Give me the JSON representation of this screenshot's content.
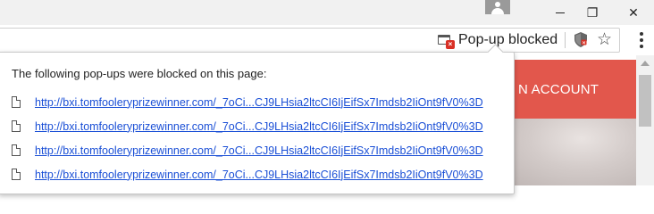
{
  "window": {
    "minimize_glyph": "",
    "maximize_glyph": "❐",
    "close_glyph": "✕"
  },
  "toolbar": {
    "popup_blocked_label": "Pop-up blocked",
    "bookmark_star": "☆",
    "icons": [
      "popup-blocked-icon",
      "shield-icon",
      "star-icon",
      "menu-icon",
      "avatar-icon"
    ]
  },
  "bubble": {
    "title": "The following pop-ups were blocked on this page:",
    "items": [
      "http://bxi.tomfooleryprizewinner.com/_7oCi...CJ9LHsia2ltcCI6IjEifSx7Imdsb2IiOnt9fV0%3D",
      "http://bxi.tomfooleryprizewinner.com/_7oCi...CJ9LHsia2ltcCI6IjEifSx7Imdsb2IiOnt9fV0%3D",
      "http://bxi.tomfooleryprizewinner.com/_7oCi...CJ9LHsia2ltcCI6IjEifSx7Imdsb2IiOnt9fV0%3D",
      "http://bxi.tomfooleryprizewinner.com/_7oCi...CJ9LHsia2ltcCI6IjEifSx7Imdsb2IiOnt9fV0%3D"
    ]
  },
  "page": {
    "banner_text": "N ACCOUNT"
  },
  "colors": {
    "banner": "#e2574c",
    "link": "#1a4fd6",
    "blocked_badge": "#d93025"
  }
}
